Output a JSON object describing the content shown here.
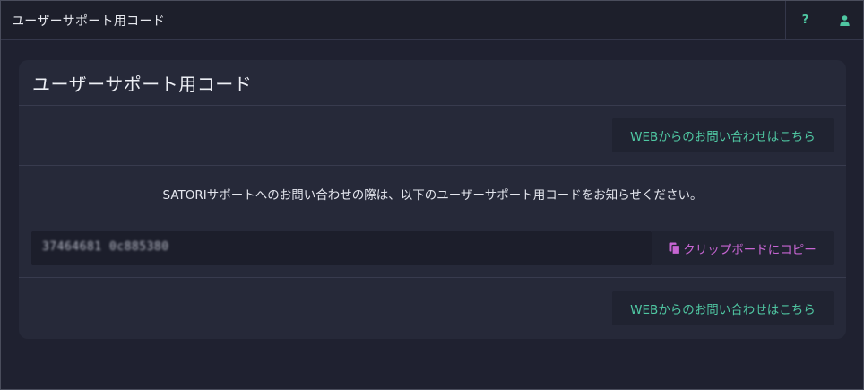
{
  "header": {
    "title": "ユーザーサポート用コード",
    "help_label": "?",
    "help_icon": "question-icon",
    "user_icon": "user-icon",
    "accent_color": "#4fc7a2"
  },
  "card": {
    "title": "ユーザーサポート用コード",
    "web_contact_label_top": "WEBからのお問い合わせはこちら",
    "notice": "SATORIサポートへのお問い合わせの際は、以下のユーザーサポート用コードをお知らせください。",
    "support_code": "37464681 0c885380",
    "copy_label": "クリップボードにコピー",
    "copy_icon": "clipboard-copy-icon",
    "copy_color": "#c665d2",
    "web_contact_label_bottom": "WEBからのお問い合わせはこちら"
  }
}
